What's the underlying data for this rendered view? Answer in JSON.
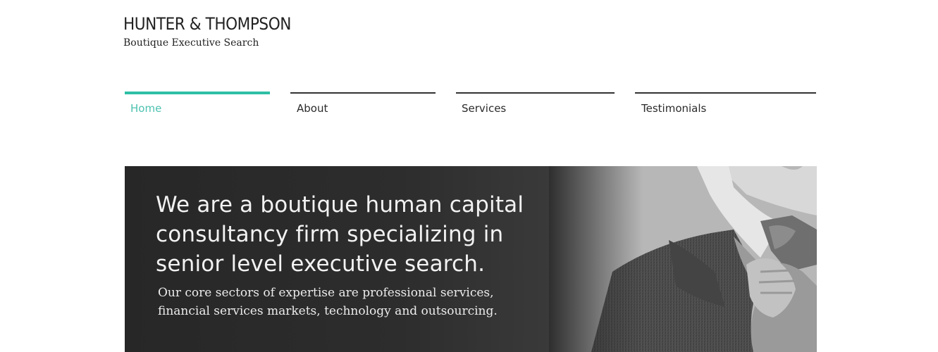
{
  "brand": {
    "title": "HUNTER & THOMPSON",
    "tagline": "Boutique Executive Search"
  },
  "nav": {
    "items": [
      {
        "label": "Home",
        "active": true
      },
      {
        "label": "About",
        "active": false
      },
      {
        "label": "Services",
        "active": false
      },
      {
        "label": "Testimonials",
        "active": false
      }
    ]
  },
  "hero": {
    "headline": "We are a boutique human capital consultancy firm specializing in senior level executive search.",
    "subtext": "Our core sectors of expertise are professional services, financial services markets, technology and outsourcing."
  },
  "colors": {
    "accent": "#2ebfa5",
    "text": "#222222",
    "hero_bg": "#2a2a2a"
  }
}
